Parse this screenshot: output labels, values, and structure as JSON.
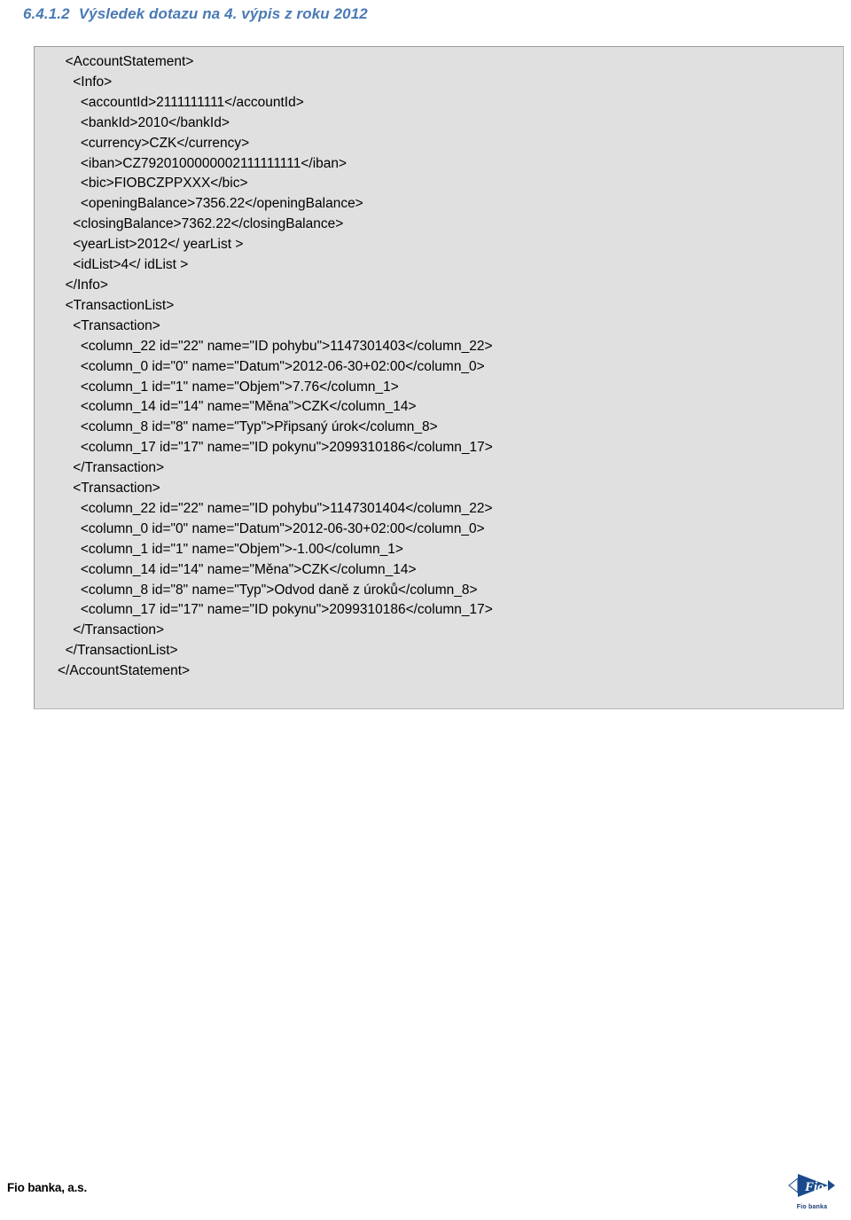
{
  "heading": {
    "number": "6.4.1.2",
    "text": "Výsledek dotazu na 4. výpis z roku 2012"
  },
  "code_block": {
    "language": "xml",
    "background_color": "#e0e0e0",
    "border_color": "#9b9b9b",
    "lines": [
      "  <AccountStatement>",
      "    <Info>",
      "      <accountId>2111111111</accountId>",
      "      <bankId>2010</bankId>",
      "      <currency>CZK</currency>",
      "      <iban>CZ7920100000002111111111</iban>",
      "      <bic>FIOBCZPPXXX</bic>",
      "      <openingBalance>7356.22</openingBalance>",
      "    <closingBalance>7362.22</closingBalance>",
      "    <yearList>2012</ yearList >",
      "    <idList>4</ idList >",
      "  </Info>",
      "  <TransactionList>",
      "    <Transaction>",
      "      <column_22 id=\"22\" name=\"ID pohybu\">1147301403</column_22>",
      "      <column_0 id=\"0\" name=\"Datum\">2012-06-30+02:00</column_0>",
      "      <column_1 id=\"1\" name=\"Objem\">7.76</column_1>",
      "      <column_14 id=\"14\" name=\"Měna\">CZK</column_14>",
      "      <column_8 id=\"8\" name=\"Typ\">Připsaný úrok</column_8>",
      "      <column_17 id=\"17\" name=\"ID pokynu\">2099310186</column_17>",
      "    </Transaction>",
      "    <Transaction>",
      "      <column_22 id=\"22\" name=\"ID pohybu\">1147301404</column_22>",
      "      <column_0 id=\"0\" name=\"Datum\">2012-06-30+02:00</column_0>",
      "      <column_1 id=\"1\" name=\"Objem\">-1.00</column_1>",
      "      <column_14 id=\"14\" name=\"Měna\">CZK</column_14>",
      "      <column_8 id=\"8\" name=\"Typ\">Odvod daně z úroků</column_8>",
      "      <column_17 id=\"17\" name=\"ID pokynu\">2099310186</column_17>",
      "    </Transaction>",
      "  </TransactionList>",
      "</AccountStatement>"
    ]
  },
  "footer": {
    "company": "Fio banka, a.s.",
    "logo_text": "Fio",
    "logo_caption": "Fio banka",
    "logo_color": "#1b4a8c"
  }
}
